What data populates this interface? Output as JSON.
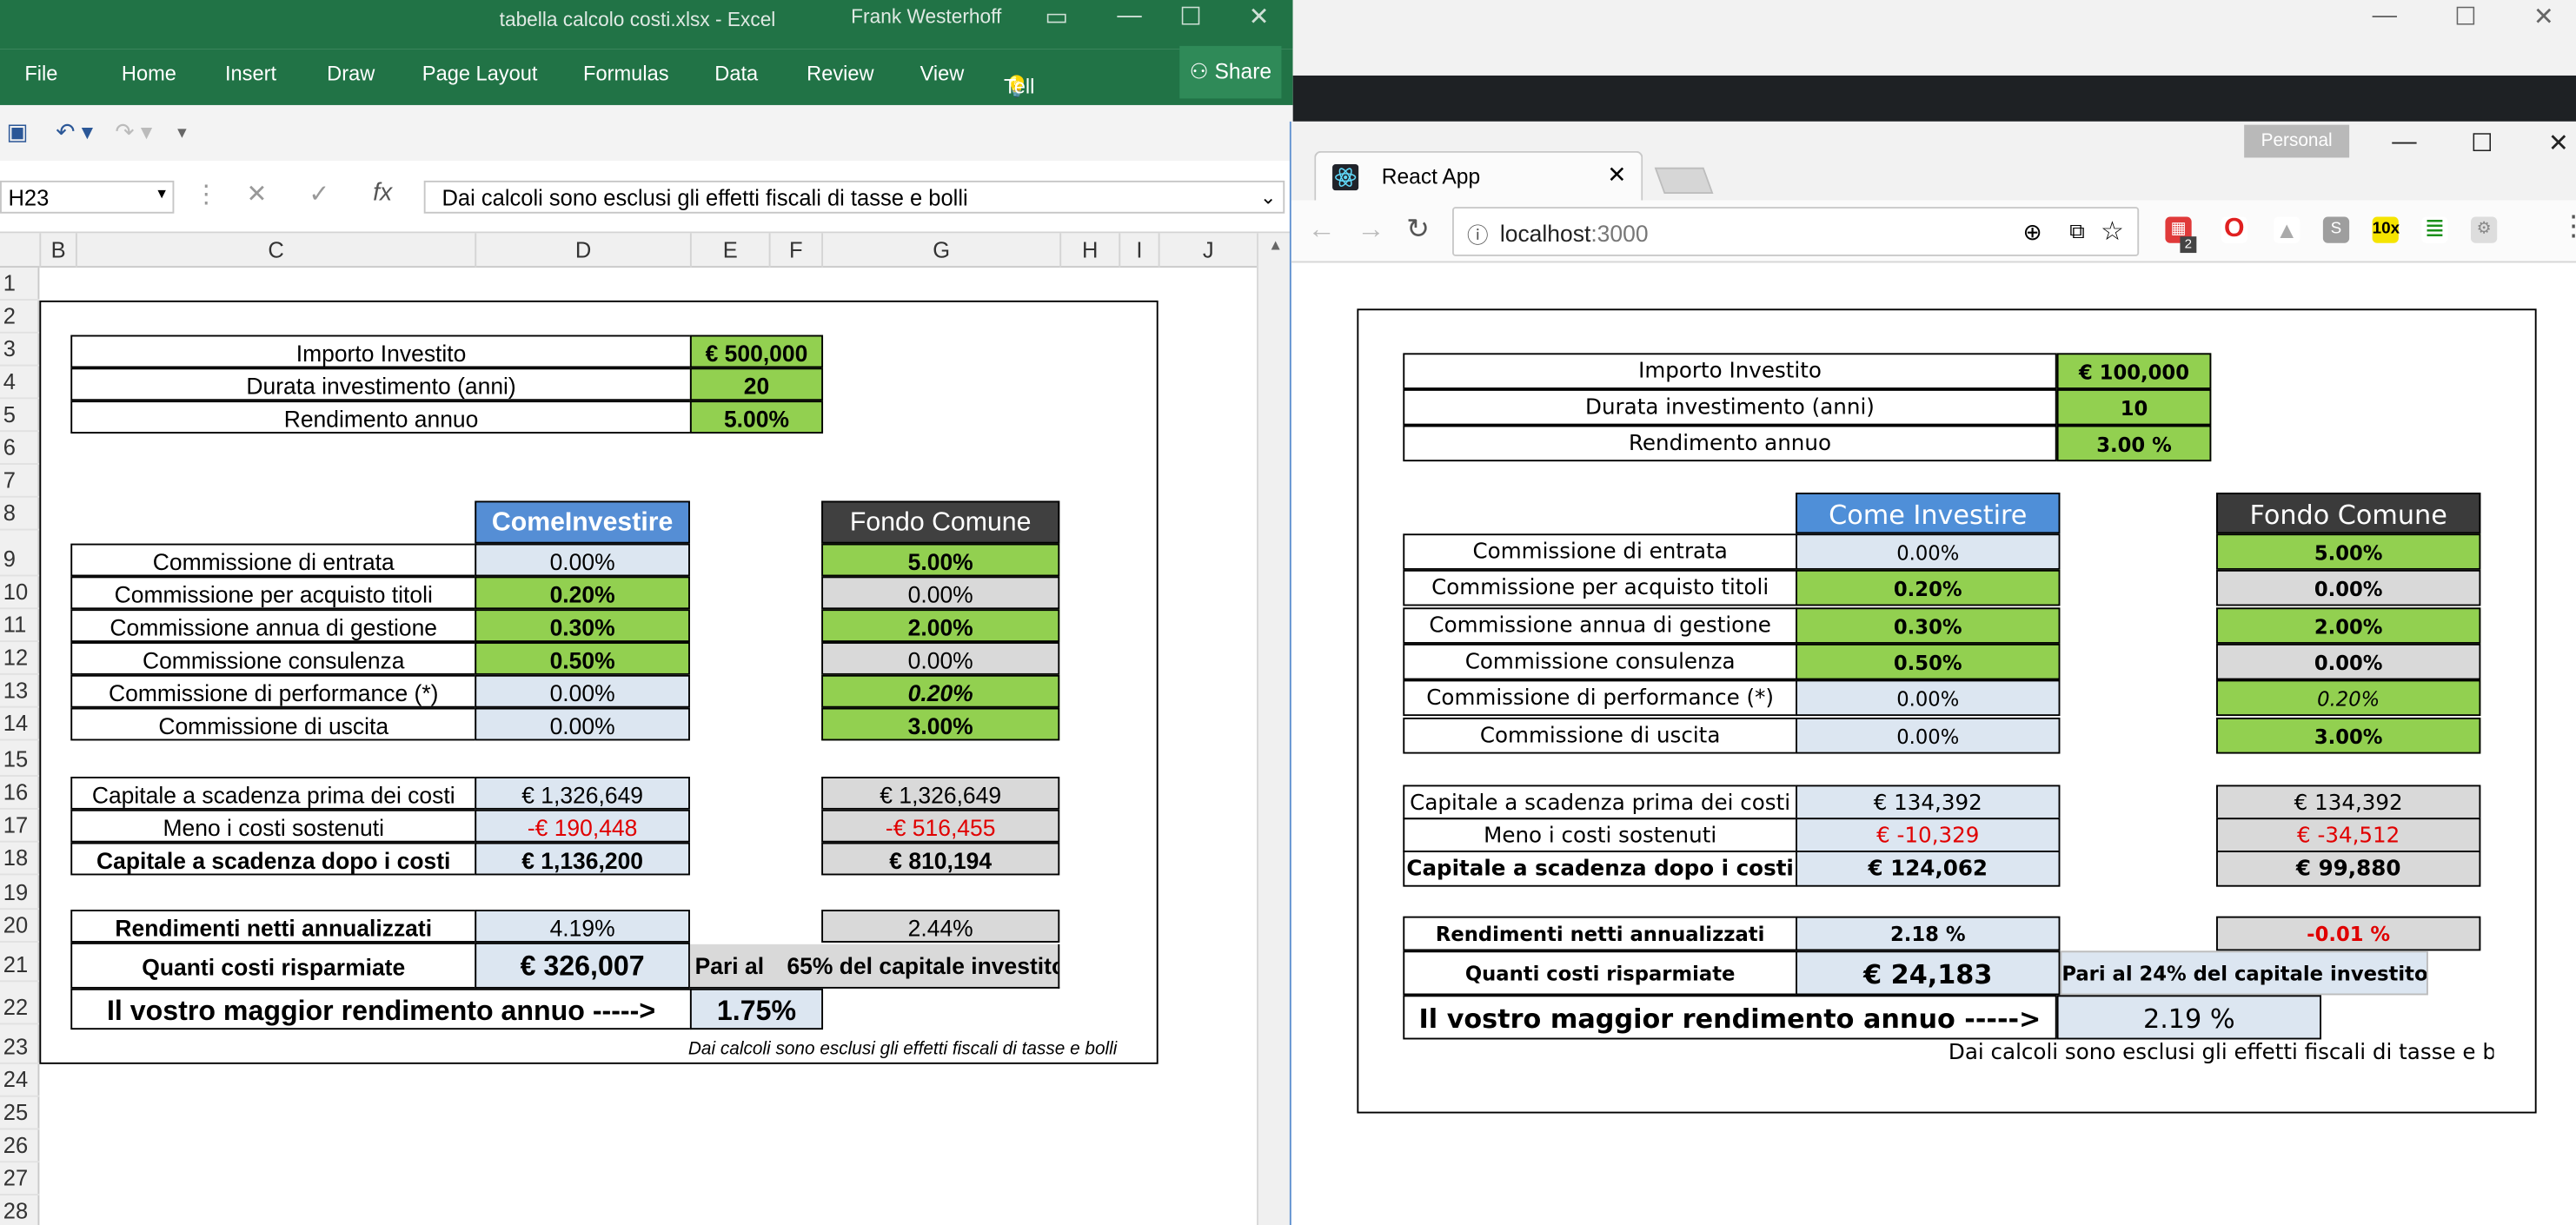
{
  "excel": {
    "title": "tabella calcolo costi.xlsx - Excel",
    "user": "Frank Westerhoff",
    "ribbon_tabs": [
      "File",
      "Home",
      "Insert",
      "Draw",
      "Page Layout",
      "Formulas",
      "Data",
      "Review",
      "View"
    ],
    "tell_me": "Tell me",
    "share": "Share",
    "name_box": "H23",
    "formula": "Dai calcoli sono esclusi gli effetti fiscali di tasse e bolli",
    "col_headers": [
      "B",
      "C",
      "D",
      "E",
      "F",
      "G",
      "H",
      "I",
      "J"
    ],
    "row_headers": [
      "1",
      "2",
      "3",
      "4",
      "5",
      "6",
      "7",
      "8",
      "9",
      "10",
      "11",
      "12",
      "13",
      "14",
      "15",
      "16",
      "17",
      "18",
      "19",
      "20",
      "21",
      "22",
      "23",
      "24",
      "25",
      "26",
      "27",
      "28"
    ],
    "top": {
      "importo_label": "Importo Investito",
      "importo_value": "€ 500,000",
      "durata_label": "Durata investimento (anni)",
      "durata_value": "20",
      "rendimento_label": "Rendimento annuo",
      "rendimento_value": "5.00%"
    },
    "hdr_ci": "ComeInvestire",
    "hdr_fc": "Fondo Comune",
    "commissions": [
      {
        "label": "Commissione di entrata",
        "ci": "0.00%",
        "fc": "5.00%"
      },
      {
        "label": "Commissione per acquisto titoli",
        "ci": "0.20%",
        "fc": "0.00%"
      },
      {
        "label": "Commissione annua di gestione",
        "ci": "0.30%",
        "fc": "2.00%"
      },
      {
        "label": "Commissione consulenza",
        "ci": "0.50%",
        "fc": "0.00%"
      },
      {
        "label": "Commissione di performance (*)",
        "ci": "0.00%",
        "fc": "0.20%"
      },
      {
        "label": "Commissione di uscita",
        "ci": "0.00%",
        "fc": "3.00%"
      }
    ],
    "capitale": [
      {
        "label": "Capitale a scadenza prima dei costi",
        "ci": "€ 1,326,649",
        "fc": "€ 1,326,649"
      },
      {
        "label": "Meno i costi sostenuti",
        "ci": "-€ 190,448",
        "fc": "-€ 516,455"
      },
      {
        "label": "Capitale a scadenza dopo i costi",
        "ci": "€ 1,136,200",
        "fc": "€ 810,194"
      }
    ],
    "rendimenti_label": "Rendimenti netti annualizzati",
    "rendimenti_ci": "4.19%",
    "rendimenti_fc": "2.44%",
    "risparmiate_label": "Quanti costi risparmiate",
    "risparmiate_value": "€ 326,007",
    "pari_al": "Pari al",
    "pari_pct": "65%",
    "pari_rest": "del capitale investito",
    "maggior_label": "Il vostro maggior rendimento annuo ----->",
    "maggior_value": "1.75%",
    "footnote": "Dai calcoli sono esclusi gli effetti fiscali di tasse e bolli"
  },
  "browser": {
    "tab_title": "React App",
    "personal": "Personal",
    "url_host": "localhost",
    "url_port": ":3000",
    "ext_badge": "2",
    "ext_10x": "10x",
    "ext_s": "S",
    "top": {
      "importo_label": "Importo Investito",
      "importo_value": "€ 100,000",
      "durata_label": "Durata investimento (anni)",
      "durata_value": "10",
      "rendimento_label": "Rendimento annuo",
      "rendimento_value": "3.00 %"
    },
    "hdr_ci": "Come Investire",
    "hdr_fc": "Fondo Comune",
    "commissions": [
      {
        "label": "Commissione di entrata",
        "ci": "0.00%",
        "fc": "5.00%"
      },
      {
        "label": "Commissione per acquisto titoli",
        "ci": "0.20%",
        "fc": "0.00%"
      },
      {
        "label": "Commissione annua di gestione",
        "ci": "0.30%",
        "fc": "2.00%"
      },
      {
        "label": "Commissione consulenza",
        "ci": "0.50%",
        "fc": "0.00%"
      },
      {
        "label": "Commissione di performance (*)",
        "ci": "0.00%",
        "fc": "0.20%"
      },
      {
        "label": "Commissione di uscita",
        "ci": "0.00%",
        "fc": "3.00%"
      }
    ],
    "capitale": [
      {
        "label": "Capitale a scadenza prima dei costi",
        "ci": "€ 134,392",
        "fc": "€ 134,392"
      },
      {
        "label": "Meno i costi sostenuti",
        "ci": "€ -10,329",
        "fc": "€ -34,512"
      },
      {
        "label": "Capitale a scadenza dopo i costi",
        "ci": "€ 124,062",
        "fc": "€ 99,880"
      }
    ],
    "rendimenti_label": "Rendimenti netti annualizzati",
    "rendimenti_ci": "2.18 %",
    "rendimenti_fc": "-0.01 %",
    "risparmiate_label": "Quanti costi risparmiate",
    "risparmiate_value": "€ 24,183",
    "pari_text": "Pari al 24% del capitale investito",
    "maggior_label": "Il vostro maggior rendimento annuo ----->",
    "maggior_value": "2.19 %",
    "footnote": "Dai calcoli sono esclusi gli effetti fiscali di tasse e bolli"
  },
  "colors": {
    "excel_green": "#217346",
    "cell_green": "#92d050",
    "cell_blue": "#dce6f1",
    "cell_gray": "#d9d9d9",
    "header_blue": "#558ed5",
    "header_dark": "#404040",
    "negative_red": "#e00000"
  }
}
